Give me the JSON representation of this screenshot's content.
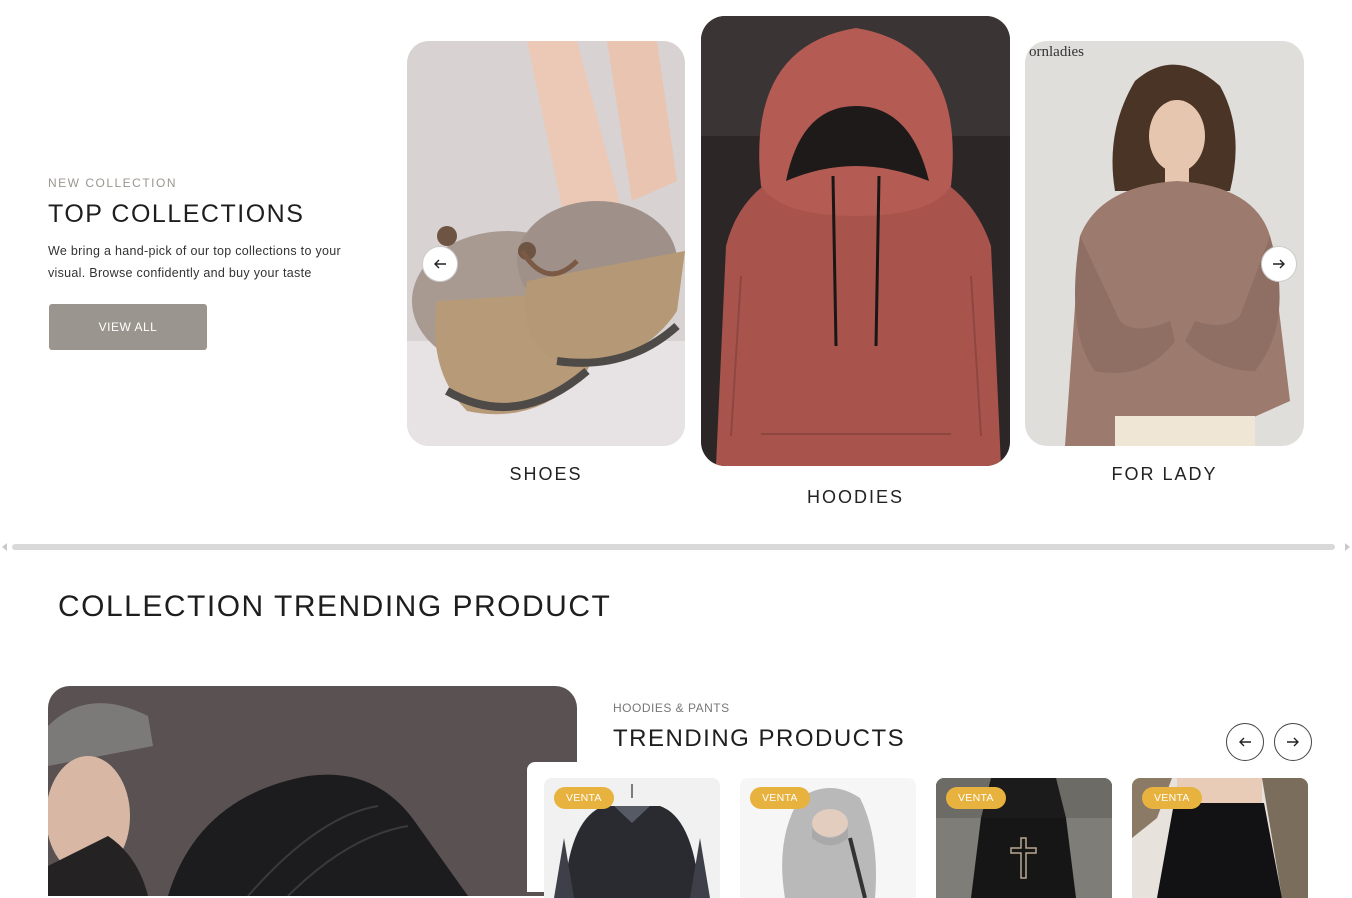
{
  "intro": {
    "eyebrow": "NEW COLLECTION",
    "title": "TOP COLLECTIONS",
    "description": "We bring a hand-pick of our top collections to your visual. Browse confidently and buy your taste",
    "button_label": "VIEW ALL"
  },
  "collections": [
    {
      "label": "SHOES",
      "image": "fur-lined-loafers-photo"
    },
    {
      "label": "HOODIES",
      "image": "red-hoodie-photo"
    },
    {
      "label": "FOR LADY",
      "image": "woman-sweatshirt-photo"
    }
  ],
  "watermark": "ornladies",
  "carousel_icons": {
    "prev": "arrow-left-icon",
    "next": "arrow-right-icon"
  },
  "trending": {
    "section_title": "COLLECTION TRENDING PRODUCT",
    "eyebrow": "HOODIES & PANTS",
    "title": "TRENDING PRODUCTS",
    "products": [
      {
        "badge": "VENTA",
        "image": "black-sweater-photo"
      },
      {
        "badge": "VENTA",
        "image": "grey-hoodie-photo"
      },
      {
        "badge": "VENTA",
        "image": "black-cross-pants-photo"
      },
      {
        "badge": "VENTA",
        "image": "black-skirt-photo"
      }
    ]
  },
  "colors": {
    "button": "#9b958f",
    "badge": "#e8b23f",
    "text": "#1e1e1e"
  }
}
